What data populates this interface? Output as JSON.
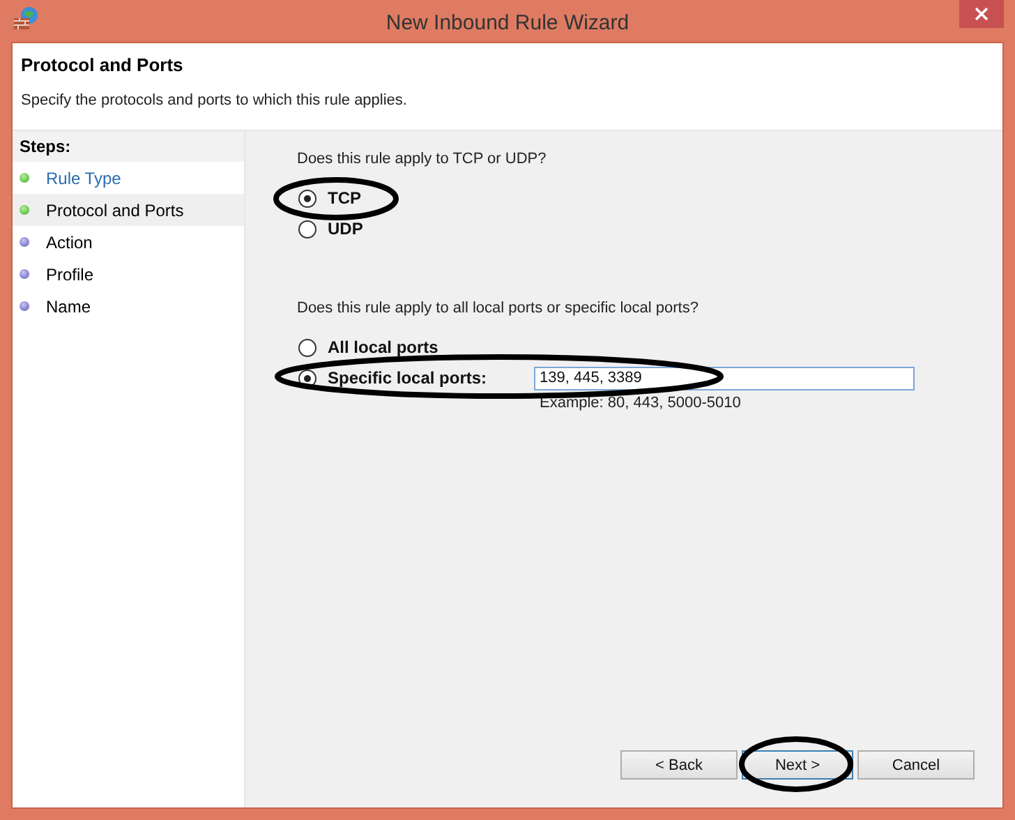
{
  "window": {
    "title": "New Inbound Rule Wizard"
  },
  "header": {
    "title": "Protocol and Ports",
    "subtitle": "Specify the protocols and ports to which this rule applies."
  },
  "steps": {
    "heading": "Steps:",
    "items": [
      {
        "label": "Rule Type",
        "completed": true,
        "selected": false
      },
      {
        "label": "Protocol and Ports",
        "completed": true,
        "selected": true
      },
      {
        "label": "Action",
        "completed": false,
        "selected": false
      },
      {
        "label": "Profile",
        "completed": false,
        "selected": false
      },
      {
        "label": "Name",
        "completed": false,
        "selected": false
      }
    ]
  },
  "protocol": {
    "question": "Does this rule apply to TCP or UDP?",
    "options": [
      {
        "label": "TCP",
        "selected": true,
        "circled": true
      },
      {
        "label": "UDP",
        "selected": false,
        "circled": false
      }
    ]
  },
  "ports": {
    "question": "Does this rule apply to all local ports or specific local ports?",
    "options": [
      {
        "label": "All local ports",
        "selected": false,
        "circled": false
      },
      {
        "label": "Specific local ports:",
        "selected": true,
        "circled": true,
        "value": "139, 445, 3389"
      }
    ],
    "example": "Example: 80, 443, 5000-5010"
  },
  "buttons": [
    {
      "label": "< Back",
      "circled": false
    },
    {
      "label": "Next >",
      "circled": true
    },
    {
      "label": "Cancel",
      "circled": false
    }
  ]
}
